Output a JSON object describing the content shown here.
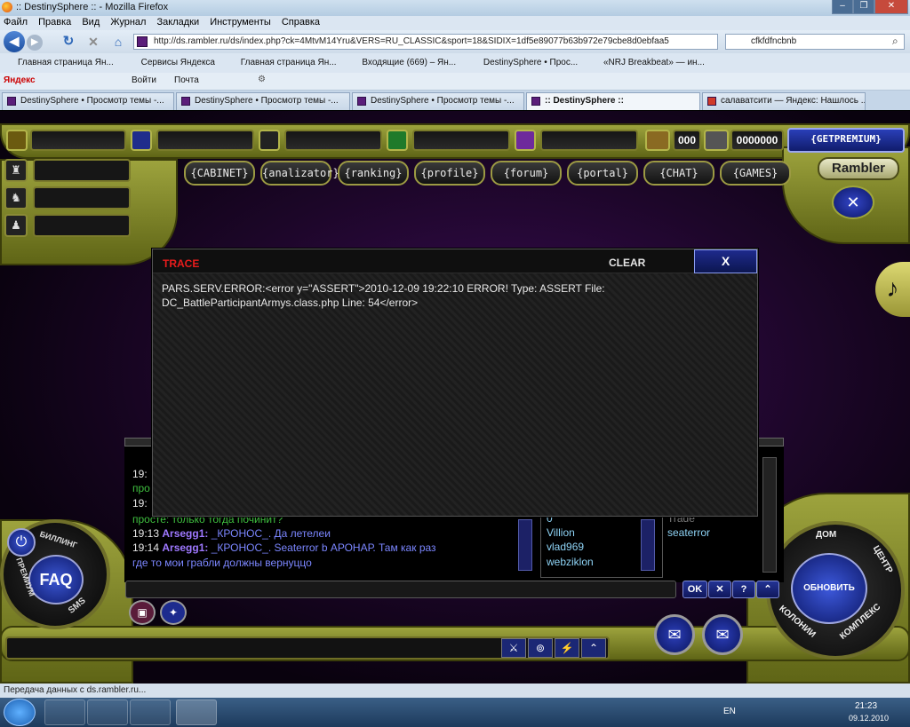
{
  "window": {
    "title": ":: DestinySphere :: - Mozilla Firefox",
    "minimize": "–",
    "restore": "❐",
    "close": "✕"
  },
  "menu": [
    "Файл",
    "Правка",
    "Вид",
    "Журнал",
    "Закладки",
    "Инструменты",
    "Справка"
  ],
  "address": {
    "url": "http://ds.rambler.ru/ds/index.php?ck=4MtvM14Yru&VERS=RU_CLASSIC&sport=18&SIDIX=1df5e89077b63b972e79cbe8d0ebfaa5",
    "search_value": "cfkfdfncbnb"
  },
  "bookmarks": [
    "Главная страница Ян...",
    "Сервисы Яндекса",
    "Главная страница Ян...",
    "Входящие (669) – Ян...",
    "DestinySphere • Прос...",
    "«NRJ Breakbeat» — ин..."
  ],
  "yandex_bar": {
    "brand": "Яндекс",
    "login": "Войти",
    "mail": "Почта"
  },
  "tabs": [
    {
      "label": "DestinySphere • Просмотр темы -...",
      "active": false
    },
    {
      "label": "DestinySphere • Просмотр темы -...",
      "active": false
    },
    {
      "label": "DestinySphere • Просмотр темы -...",
      "active": false
    },
    {
      "label": ":: DestinySphere ::",
      "active": true
    },
    {
      "label": "салаватсити — Яндекс: Нашлось ...",
      "active": false
    }
  ],
  "game": {
    "counter_1": "000",
    "counter_2": "0000000",
    "premium_button": "{GETPREMIUM}",
    "nav": [
      "{CABINET}",
      "{analizator}",
      "{ranking}",
      "{profile}",
      "{forum}",
      "{portal}",
      "{CHAT}",
      "{GAMES}"
    ],
    "logo": "Rambler",
    "music_note": "♪",
    "faq": "FAQ",
    "ring_left": [
      "БИЛЛИНГ",
      "ПРЕМИУМ",
      "SMS"
    ],
    "ring_right": [
      "ДОМ",
      "ЦЕНТР",
      "КОМПЛЕКС",
      "КОЛОНИИ",
      "Л"
    ],
    "refresh_button": "ОБНОВИТЬ",
    "ok_button": "OK",
    "help_button": "?",
    "colors": {
      "accent_olive": "#8f9326",
      "trace_red": "#e81c1c",
      "nick_purple": "#9e78ff"
    }
  },
  "trace": {
    "title": "TRACE",
    "clear": "CLEAR",
    "close": "X",
    "message": "PARS.SERV.ERROR:<error y=\"ASSERT\">2010-12-09 19:22:10 ERROR! Type: ASSERT File: DC_BattleParticipantArmys.class.php Line: 54</error>"
  },
  "chat": {
    "partial_1": "19:",
    "partial_2": "про",
    "partial_3": "19:",
    "green_line": "просте: только тогда починит?",
    "line_1": {
      "time": "19:13",
      "nick": "Arsegg1:",
      "text": "_КРОНОС_. Да летелеи"
    },
    "line_2": {
      "time": "19:14",
      "nick": "Arsegg1:",
      "text": "_КРОНОС_. Seaterror b АРОНАР. Там как раз"
    },
    "line_2b": "где то мои грабли должны вернуццо",
    "users": [
      "0",
      "Villion",
      "vlad969",
      "webziklon"
    ],
    "right_users": [
      "Trade",
      "seaterror"
    ]
  },
  "status": "Передача данных с ds.rambler.ru...",
  "taskbar": {
    "lang": "EN",
    "time": "21:23",
    "date": "09.12.2010"
  }
}
